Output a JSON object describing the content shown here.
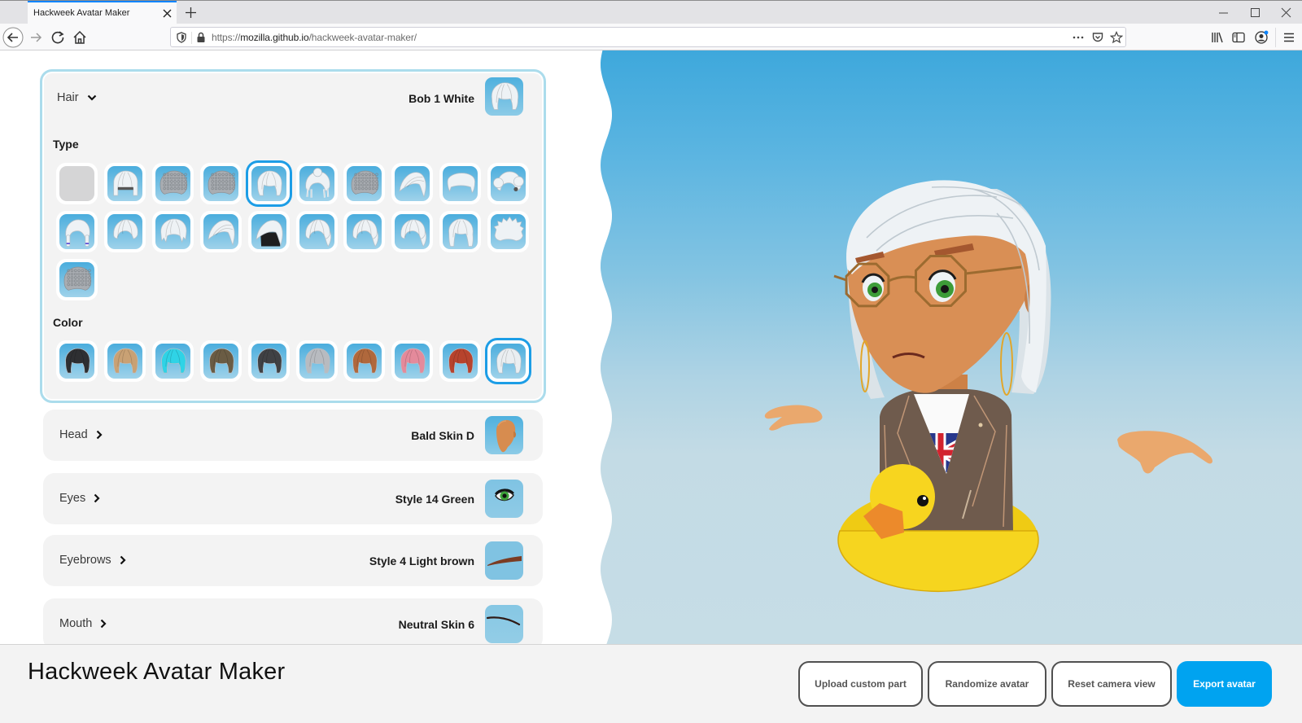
{
  "browser": {
    "tab_title": "Hackweek Avatar Maker",
    "url": {
      "prefix": "https://",
      "host": "mozilla.github.io",
      "path": "/hackweek-avatar-maker/"
    }
  },
  "panel": {
    "hair": {
      "category": "Hair",
      "selected_value": "Bob 1 White",
      "expanded": true,
      "type_label": "Type",
      "types": [
        {
          "variant": "none"
        },
        {
          "variant": "bob-helmet"
        },
        {
          "variant": "curly"
        },
        {
          "variant": "curly"
        },
        {
          "variant": "bob",
          "selected": true
        },
        {
          "variant": "bun"
        },
        {
          "variant": "curly"
        },
        {
          "variant": "swept"
        },
        {
          "variant": "flat"
        },
        {
          "variant": "buns"
        },
        {
          "variant": "braids"
        },
        {
          "variant": "dome"
        },
        {
          "variant": "shaggy"
        },
        {
          "variant": "swept"
        },
        {
          "variant": "two-tone"
        },
        {
          "variant": "ponytail"
        },
        {
          "variant": "ponytail"
        },
        {
          "variant": "ponytail"
        },
        {
          "variant": "long"
        },
        {
          "variant": "spiky"
        },
        {
          "variant": "curly"
        }
      ],
      "color_label": "Color",
      "colors": [
        {
          "name": "black",
          "hex": "#2e2f32"
        },
        {
          "name": "blonde",
          "hex": "#c9a174"
        },
        {
          "name": "cyan",
          "hex": "#2fd3e6"
        },
        {
          "name": "olive-brown",
          "hex": "#6a5c44"
        },
        {
          "name": "dark-gray",
          "hex": "#404144"
        },
        {
          "name": "silver",
          "hex": "#b8bbc0"
        },
        {
          "name": "copper",
          "hex": "#b0683c"
        },
        {
          "name": "pink",
          "hex": "#e48a9b"
        },
        {
          "name": "red",
          "hex": "#b7432d"
        },
        {
          "name": "white",
          "hex": "#eaeef1",
          "selected": true
        }
      ]
    },
    "categories": [
      {
        "category": "Head",
        "selected_value": "Bald Skin D",
        "thumb": "head"
      },
      {
        "category": "Eyes",
        "selected_value": "Style 14 Green",
        "thumb": "eye"
      },
      {
        "category": "Eyebrows",
        "selected_value": "Style 4 Light brown",
        "thumb": "eyebrow"
      },
      {
        "category": "Mouth",
        "selected_value": "Neutral Skin 6",
        "thumb": "mouth"
      }
    ]
  },
  "footer": {
    "title": "Hackweek Avatar Maker",
    "buttons": [
      {
        "label": "Upload custom part",
        "primary": false
      },
      {
        "label": "Randomize avatar",
        "primary": false
      },
      {
        "label": "Reset camera view",
        "primary": false
      },
      {
        "label": "Export avatar",
        "primary": true
      }
    ]
  },
  "theme": {
    "accent": "#00a3f0",
    "selection_border": "#1c9de6",
    "panel_border": "#abdcec",
    "tab_indicator": "#0a84ff"
  }
}
